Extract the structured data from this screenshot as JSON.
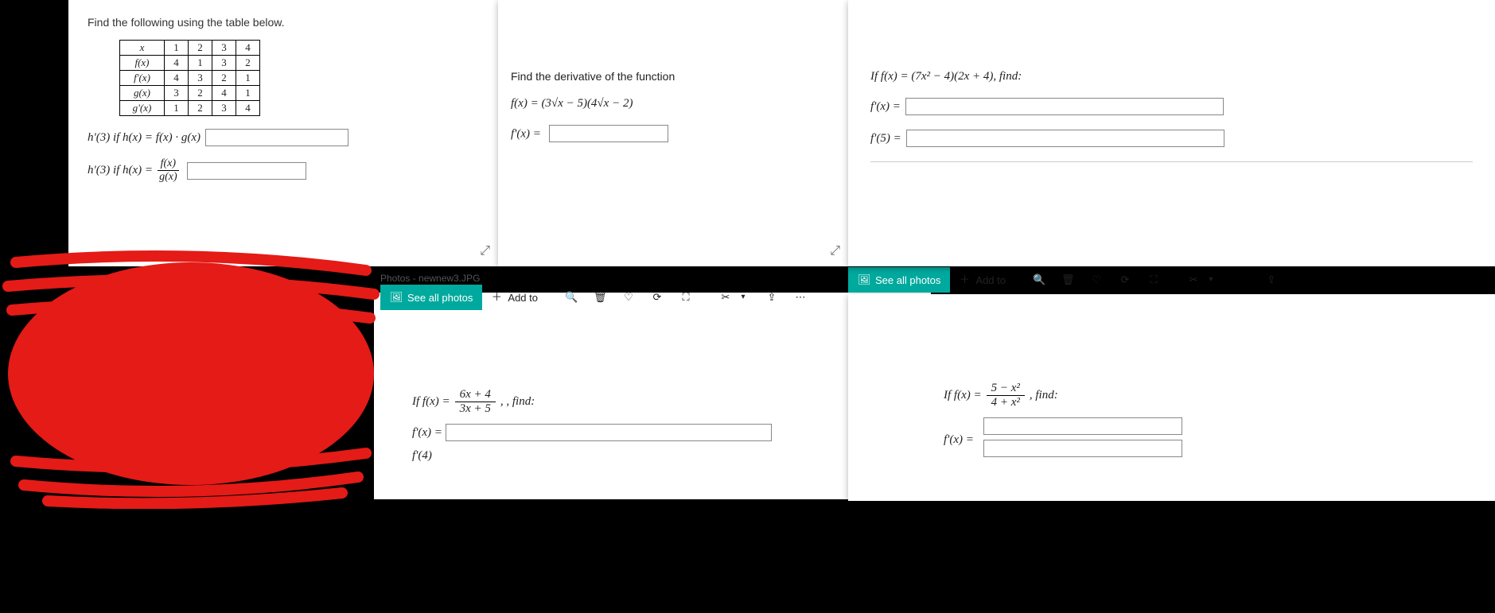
{
  "p1": {
    "prompt": "Find the following using the table below.",
    "table": {
      "rows": [
        {
          "label": "x",
          "cells": [
            "1",
            "2",
            "3",
            "4"
          ]
        },
        {
          "label": "f(x)",
          "cells": [
            "4",
            "1",
            "3",
            "2"
          ]
        },
        {
          "label": "f'(x)",
          "cells": [
            "4",
            "3",
            "2",
            "1"
          ]
        },
        {
          "label": "g(x)",
          "cells": [
            "3",
            "2",
            "4",
            "1"
          ]
        },
        {
          "label": "g'(x)",
          "cells": [
            "1",
            "2",
            "3",
            "4"
          ]
        }
      ]
    },
    "q1_prefix": "h'(3) if h(x) = f(x) · g(x)",
    "q2_prefix": "h'(3) if h(x) =",
    "q2_frac_num": "f(x)",
    "q2_frac_den": "g(x)"
  },
  "p2": {
    "prompt": "Find the derivative of the function",
    "fn": "f(x) = (3√x − 5)(4√x − 2)",
    "answer_label": "f'(x) ="
  },
  "p3": {
    "prompt": "If f(x) = (7x² − 4)(2x + 4), find:",
    "l1": "f'(x) =",
    "l2": "f'(5) ="
  },
  "photos": {
    "title_tab": "Photos - newnew3.JPG",
    "see_all": "See all photos",
    "add_to": "Add to"
  },
  "p4": {
    "prompt_pre": "If f(x) =",
    "frac_num": "6x + 4",
    "frac_den": "3x + 5",
    "prompt_post": ", , find:",
    "l1": "f'(x) =",
    "l2": "f'(4)"
  },
  "p5": {
    "prompt_pre": "If f(x) =",
    "frac_num": "5 − x²",
    "frac_den": "4 + x²",
    "prompt_post": ", find:",
    "l1": "f'(x) ="
  }
}
